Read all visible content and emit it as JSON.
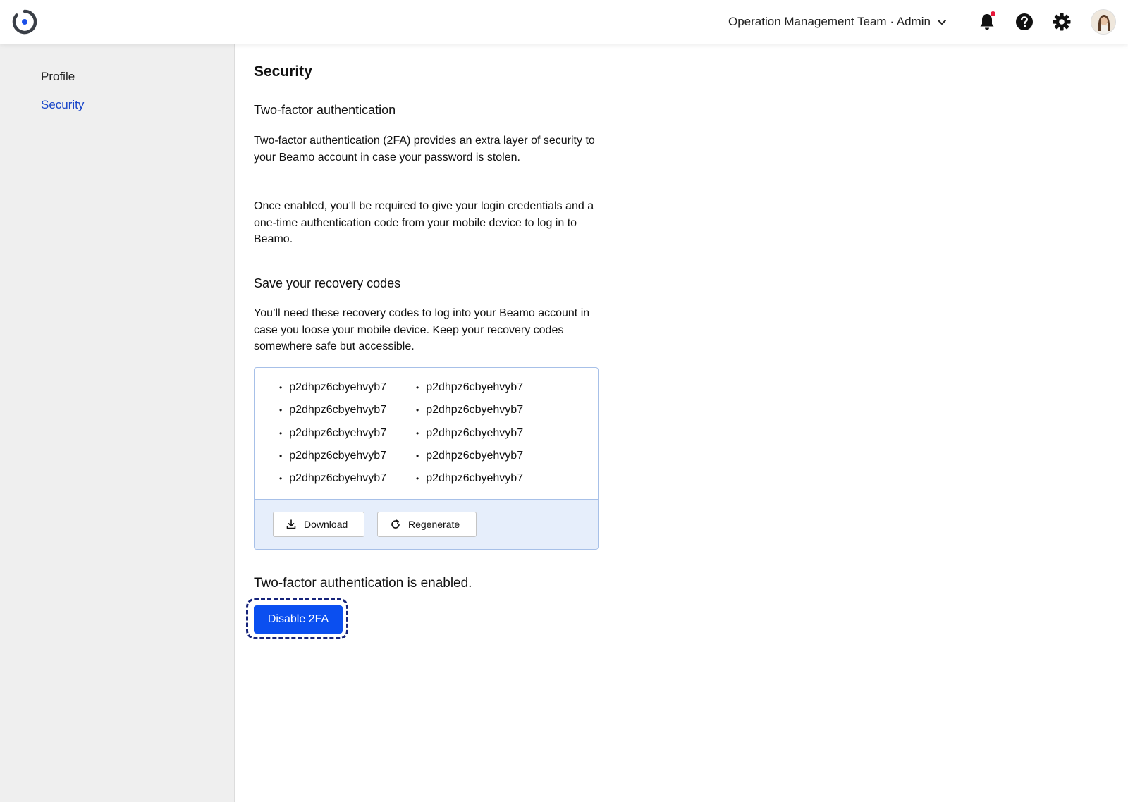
{
  "header": {
    "team_label": "Operation Management Team · Admin",
    "icons": [
      "logo-icon",
      "chevron-down-icon",
      "bell-icon",
      "help-icon",
      "gear-icon",
      "avatar"
    ],
    "notification_dot_color": "#e8173a"
  },
  "sidebar": {
    "items": [
      {
        "label": "Profile",
        "active": false
      },
      {
        "label": "Security",
        "active": true
      }
    ],
    "active_color": "#1a47c9"
  },
  "main": {
    "title": "Security",
    "two_factor": {
      "heading": "Two-factor authentication",
      "paragraph1": "Two-factor authentication (2FA) provides an extra layer of security to your Beamo account in case your password is stolen.",
      "paragraph2": "Once enabled, you’ll be required to give your login credentials and a one-time authentication code from your mobile device to log in to Beamo."
    },
    "recovery": {
      "heading": "Save your recovery codes",
      "paragraph": "You’ll need these recovery codes to log into your Beamo account in case you loose your mobile device. Keep your recovery codes somewhere safe but accessible.",
      "codes": [
        "p2dhpz6cbyehvyb7",
        "p2dhpz6cbyehvyb7",
        "p2dhpz6cbyehvyb7",
        "p2dhpz6cbyehvyb7",
        "p2dhpz6cbyehvyb7",
        "p2dhpz6cbyehvyb7",
        "p2dhpz6cbyehvyb7",
        "p2dhpz6cbyehvyb7",
        "p2dhpz6cbyehvyb7",
        "p2dhpz6cbyehvyb7"
      ],
      "download_label": "Download",
      "regenerate_label": "Regenerate"
    },
    "status_text": "Two-factor authentication is enabled.",
    "disable_label": "Disable 2FA",
    "primary_color": "#0b4ff0"
  }
}
